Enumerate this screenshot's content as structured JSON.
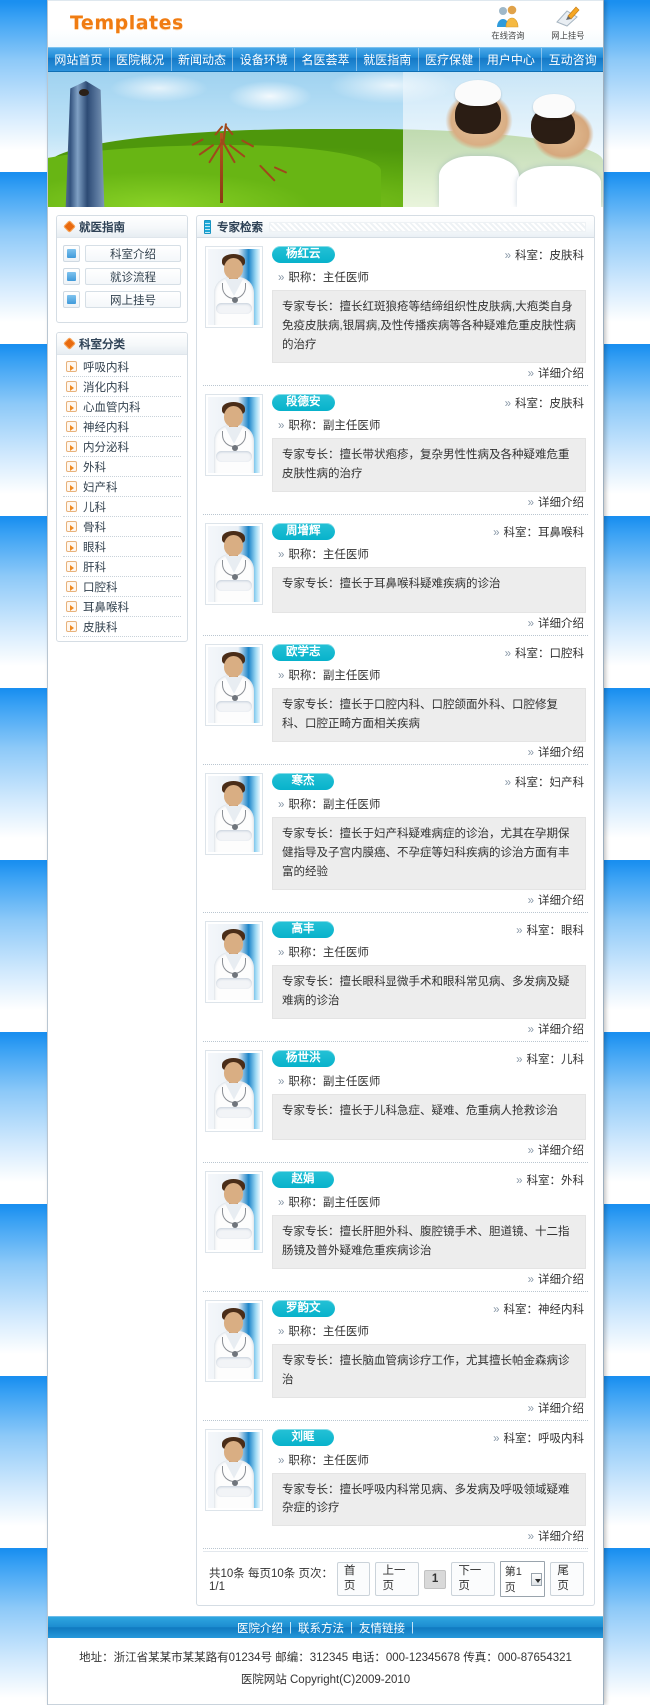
{
  "header": {
    "logo": "Templates",
    "tools": [
      {
        "icon": "online-consult-icon",
        "label": "在线咨询"
      },
      {
        "icon": "online-register-icon",
        "label": "网上挂号"
      }
    ]
  },
  "nav": {
    "items": [
      "网站首页",
      "医院概况",
      "新闻动态",
      "设备环境",
      "名医荟萃",
      "就医指南",
      "医疗保健",
      "用户中心",
      "互动咨询"
    ]
  },
  "sidebar": {
    "guide": {
      "title": "就医指南",
      "items": [
        "科室介绍",
        "就诊流程",
        "网上挂号"
      ]
    },
    "depts": {
      "title": "科室分类",
      "items": [
        "呼吸内科",
        "消化内科",
        "心血管内科",
        "神经内科",
        "内分泌科",
        "外科",
        "妇产科",
        "儿科",
        "骨科",
        "眼科",
        "肝科",
        "口腔科",
        "耳鼻喉科",
        "皮肤科"
      ]
    }
  },
  "main": {
    "section_title": "专家检索",
    "labels": {
      "dept_prefix": "科室：",
      "title_prefix": "职称：",
      "specialty_prefix": "专家专长：",
      "detail": "详细介绍",
      "chev": "»"
    },
    "experts": [
      {
        "name": "杨红云",
        "dept": "皮肤科",
        "title": "主任医师",
        "specialty": "擅长红斑狼疮等结缔组织性皮肤病,大疱类自身免疫皮肤病,银屑病,及性传播疾病等各种疑难危重皮肤性病的治疗"
      },
      {
        "name": "段德安",
        "dept": "皮肤科",
        "title": "副主任医师",
        "specialty": "擅长带状疱疹，复杂男性性病及各种疑难危重皮肤性病的治疗"
      },
      {
        "name": "周增辉",
        "dept": "耳鼻喉科",
        "title": "主任医师",
        "specialty": "擅长于耳鼻喉科疑难疾病的诊治"
      },
      {
        "name": "欧学志",
        "dept": "口腔科",
        "title": "副主任医师",
        "specialty": "擅长于口腔内科、口腔颌面外科、口腔修复科、口腔正畸方面相关疾病"
      },
      {
        "name": "寒杰",
        "dept": "妇产科",
        "title": "副主任医师",
        "specialty": "擅长于妇产科疑难病症的诊治，尤其在孕期保健指导及子宫内膜癌、不孕症等妇科疾病的诊治方面有丰富的经验"
      },
      {
        "name": "高丰",
        "dept": "眼科",
        "title": "主任医师",
        "specialty": "擅长眼科显微手术和眼科常见病、多发病及疑难病的诊治"
      },
      {
        "name": "杨世洪",
        "dept": "儿科",
        "title": "副主任医师",
        "specialty": "擅长于儿科急症、疑难、危重病人抢救诊治"
      },
      {
        "name": "赵娟",
        "dept": "外科",
        "title": "副主任医师",
        "specialty": "擅长肝胆外科、腹腔镜手术、胆道镜、十二指肠镜及普外疑难危重疾病诊治"
      },
      {
        "name": "罗韵文",
        "dept": "神经内科",
        "title": "主任医师",
        "specialty": "擅长脑血管病诊疗工作，尤其擅长帕金森病诊治"
      },
      {
        "name": "刘眶",
        "dept": "呼吸内科",
        "title": "主任医师",
        "specialty": "擅长呼吸内科常见病、多发病及呼吸领域疑难杂症的诊疗"
      }
    ],
    "pager": {
      "info": "共10条 每页10条 页次：1/1",
      "first": "首页",
      "prev": "上一页",
      "current": "1",
      "next": "下一页",
      "select_value": "第1页",
      "last": "尾页"
    }
  },
  "footer": {
    "links": [
      "医院介绍",
      "联系方法",
      "友情链接"
    ],
    "separator": "|",
    "address": "地址：浙江省某某市某某路有01234号 邮编：312345 电话：000-12345678 传真：000-87654321",
    "copyright": "医院网站 Copyright(C)2009-2010"
  },
  "colors": {
    "brand_orange": "#f07c12",
    "nav_blue": "#1f8ad6",
    "name_badge": "#07b2cb",
    "panel_border": "#d5dde4"
  }
}
